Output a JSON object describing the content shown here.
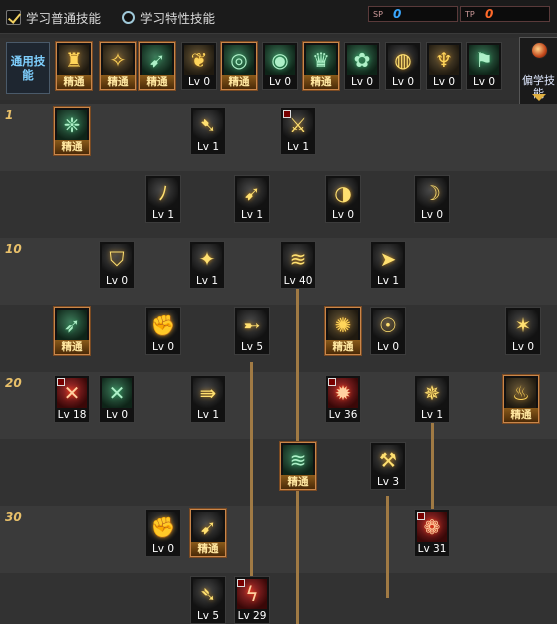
{
  "toggles": {
    "normal": "学习普通技能",
    "trait": "学习特性技能"
  },
  "points": {
    "sp_label": "SP",
    "sp": "0",
    "tp_label": "TP",
    "tp": "0"
  },
  "common_label": "通用技能",
  "side_button": "偏学技能",
  "level_labels": [
    "1",
    "10",
    "20",
    "30"
  ],
  "common_skills": [
    {
      "icon": "♜",
      "tint": "gold",
      "lbl": "精通"
    },
    {
      "icon": "✧",
      "tint": "gold",
      "lbl": "精通"
    },
    {
      "icon": "➹",
      "tint": "green",
      "lbl": "精通"
    },
    {
      "icon": "❦",
      "tint": "gold",
      "lbl": "Lv 0"
    },
    {
      "icon": "◎",
      "tint": "green",
      "lbl": "精通"
    },
    {
      "icon": "◉",
      "tint": "green",
      "lbl": "Lv 0"
    },
    {
      "icon": "♛",
      "tint": "green",
      "lbl": "精通"
    },
    {
      "icon": "✿",
      "tint": "green",
      "lbl": "Lv 0"
    },
    {
      "icon": "◍",
      "tint": "dark",
      "lbl": "Lv 0"
    },
    {
      "icon": "♆",
      "tint": "gold",
      "lbl": "Lv 0"
    },
    {
      "icon": "⚑",
      "tint": "green",
      "lbl": "Lv 0"
    }
  ],
  "skills": [
    {
      "icon": "❈",
      "tint": "green",
      "lbl": "精通",
      "corner": false
    },
    {
      "icon": "➷",
      "tint": "dark",
      "lbl": "Lv 1",
      "corner": false
    },
    {
      "icon": "⚔",
      "tint": "dark",
      "lbl": "Lv 1",
      "corner": true
    },
    {
      "icon": "ﾉ",
      "tint": "dark",
      "lbl": "Lv 1",
      "corner": false
    },
    {
      "icon": "➹",
      "tint": "dark",
      "lbl": "Lv 1",
      "corner": false
    },
    {
      "icon": "◑",
      "tint": "dark",
      "lbl": "Lv 0",
      "corner": false
    },
    {
      "icon": "☽",
      "tint": "dark",
      "lbl": "Lv 0",
      "corner": false
    },
    {
      "icon": "⛉",
      "tint": "dark",
      "lbl": "Lv 0",
      "corner": false
    },
    {
      "icon": "✦",
      "tint": "dark",
      "lbl": "Lv 1",
      "corner": false
    },
    {
      "icon": "≋",
      "tint": "dark",
      "lbl": "Lv 40",
      "corner": false
    },
    {
      "icon": "➤",
      "tint": "dark",
      "lbl": "Lv 1",
      "corner": false
    },
    {
      "icon": "➶",
      "tint": "green",
      "lbl": "精通",
      "corner": false
    },
    {
      "icon": "✊",
      "tint": "dark",
      "lbl": "Lv 0",
      "corner": false
    },
    {
      "icon": "➸",
      "tint": "dark",
      "lbl": "Lv 5",
      "corner": false
    },
    {
      "icon": "✺",
      "tint": "gold",
      "lbl": "精通",
      "corner": false
    },
    {
      "icon": "☉",
      "tint": "dark",
      "lbl": "Lv 0",
      "corner": false
    },
    {
      "icon": "✶",
      "tint": "dark",
      "lbl": "Lv 0",
      "corner": false
    },
    {
      "icon": "✕",
      "tint": "red",
      "lbl": "Lv 18",
      "corner": true
    },
    {
      "icon": "✕",
      "tint": "green",
      "lbl": "Lv 0",
      "corner": false
    },
    {
      "icon": "⇛",
      "tint": "dark",
      "lbl": "Lv 1",
      "corner": false
    },
    {
      "icon": "✹",
      "tint": "red",
      "lbl": "Lv 36",
      "corner": true
    },
    {
      "icon": "✵",
      "tint": "dark",
      "lbl": "Lv 1",
      "corner": false
    },
    {
      "icon": "♨",
      "tint": "gold",
      "lbl": "精通",
      "corner": false
    },
    {
      "icon": "≋",
      "tint": "green",
      "lbl": "精通",
      "corner": false
    },
    {
      "icon": "⚒",
      "tint": "dark",
      "lbl": "Lv 3",
      "corner": false
    },
    {
      "icon": "✊",
      "tint": "dark",
      "lbl": "Lv 0",
      "corner": false
    },
    {
      "icon": "➹",
      "tint": "dark",
      "lbl": "精通",
      "corner": false
    },
    {
      "icon": "❁",
      "tint": "red",
      "lbl": "Lv 31",
      "corner": true
    },
    {
      "icon": "➴",
      "tint": "dark",
      "lbl": "Lv 5",
      "corner": false
    },
    {
      "icon": "ϟ",
      "tint": "red",
      "lbl": "Lv 29",
      "corner": true
    }
  ]
}
